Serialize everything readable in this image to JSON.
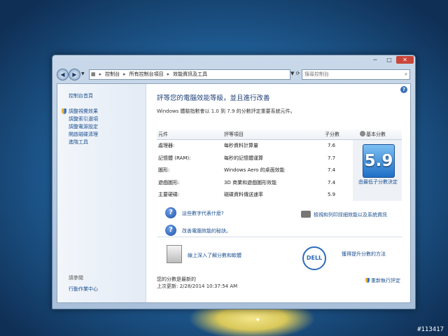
{
  "window": {
    "controls": {
      "min": "─",
      "max": "□",
      "close": "✕"
    }
  },
  "nav": {
    "back": "◀",
    "forward": "▶",
    "breadcrumb": [
      "控制台",
      "所有控制台項目",
      "效能資訊及工具"
    ],
    "search_placeholder": "搜尋控制台"
  },
  "sidebar": {
    "home": "控制台首頁",
    "links": [
      "調整視覺效果",
      "調整索引選項",
      "調整電源設定",
      "開啟磁碟清理",
      "進階工具"
    ],
    "see_also": "請參閱",
    "action_center": "行動作業中心"
  },
  "main": {
    "title": "評等您的電腦效能等級，並且進行改善",
    "description": "Windows 體驗指數會以 1.0 到 7.9 的分數評定重要系統元件。",
    "table": {
      "headers": [
        "元件",
        "評等項目",
        "子分數",
        "基本分數"
      ],
      "rows": [
        {
          "component": "處理器:",
          "rating": "每秒資料計算量",
          "score": "7.6"
        },
        {
          "component": "記憶體 (RAM):",
          "rating": "每秒的記憶體運算",
          "score": "7.7"
        },
        {
          "component": "圖形:",
          "rating": "Windows Aero 的桌面效能",
          "score": "7.4"
        },
        {
          "component": "遊戲圖形:",
          "rating": "3D 商業和遊戲圖形效能",
          "score": "7.4"
        },
        {
          "component": "主要硬碟:",
          "rating": "磁碟資料傳送速率",
          "score": "5.9"
        }
      ],
      "base_score": "5.9",
      "base_label": "由最低子分數決定"
    },
    "links": {
      "what_mean": "這些數字代表什麼?",
      "tips": "改善電腦效能的秘訣。",
      "print": "檢視和列印詳細效能以及系統資訊",
      "online": "線上深入了解分數和軟體",
      "improve": "獲得提升分數的方法"
    },
    "status": {
      "line1": "您的分數是最新的",
      "line2": "上次更新: 2/28/2014 10:37:54 AM"
    },
    "rerun": "重新執行評定",
    "dell": "DELL"
  },
  "watermark": "#113417"
}
